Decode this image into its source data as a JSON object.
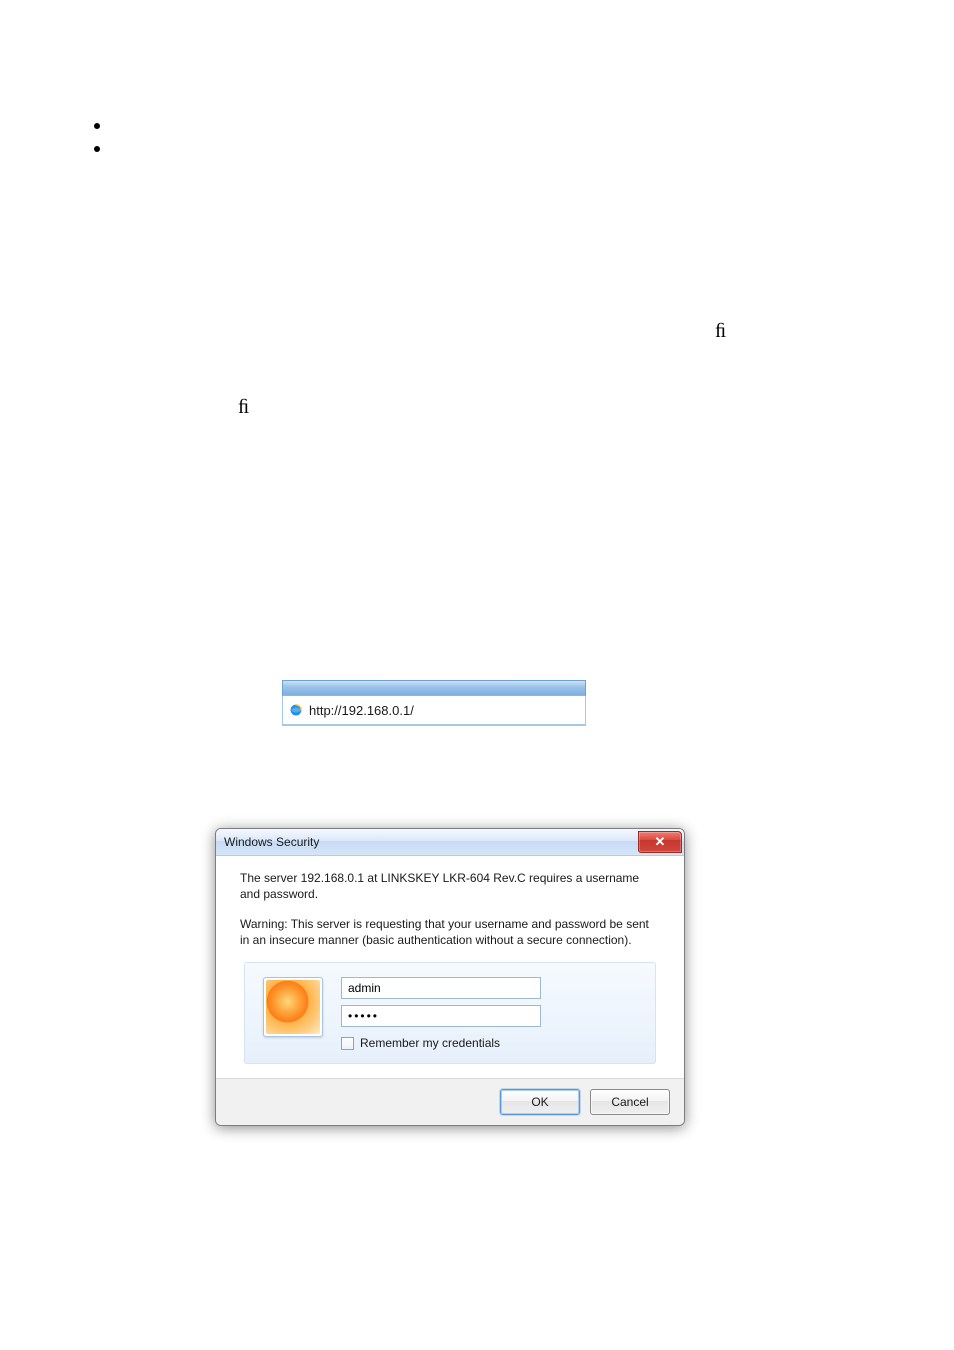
{
  "bullets": {
    "b1": "",
    "b2": ""
  },
  "glyphs": {
    "fi1": "ﬁ",
    "fi2": "ﬁ"
  },
  "address_bar": {
    "url": "http://192.168.0.1/"
  },
  "dialog": {
    "title": "Windows Security",
    "msg1": "The server 192.168.0.1 at LINKSKEY LKR-604 Rev.C requires a username and password.",
    "msg2": "Warning: This server is requesting that your username and password be sent in an insecure manner (basic authentication without a secure connection).",
    "username_value": "admin",
    "password_value": "•••••",
    "remember_label": "Remember my credentials",
    "ok_label": "OK",
    "cancel_label": "Cancel",
    "close_glyph": "✕"
  }
}
